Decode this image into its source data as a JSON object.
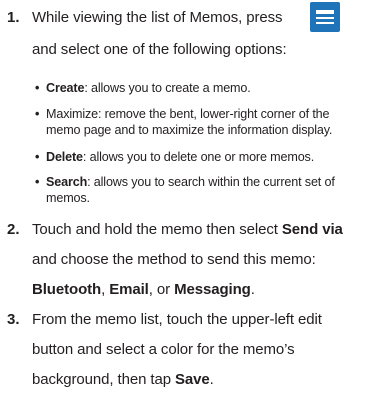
{
  "steps": [
    {
      "number": "1.",
      "line1_text": "While viewing the list of Memos, press",
      "line2_text": "and select one of the following options:",
      "icon": "menu-icon",
      "bullets": [
        {
          "bold": "Create",
          "rest": ": allows you to create a memo.",
          "rest2": ""
        },
        {
          "bold": "",
          "rest": "Maximize: remove the bent, lower-right corner of the",
          "rest2": "memo page and to maximize the information display."
        },
        {
          "bold": "Delete",
          "rest": ": allows you to delete one or more memos.",
          "rest2": ""
        },
        {
          "bold": "Search",
          "rest": ": allows you to search within the current set of",
          "rest2": "memos."
        }
      ]
    },
    {
      "number": "2.",
      "line1_text": "Touch and hold the memo then select ",
      "line1_bold": "Send via",
      "line2_text": "and choose the method to send this memo:",
      "line3_b1": "Bluetooth",
      "line3_sep1": ", ",
      "line3_b2": "Email",
      "line3_sep2": ", or ",
      "line3_b3": "Messaging",
      "line3_end": "."
    },
    {
      "number": "3.",
      "line1_text": "From the memo list, touch the upper-left edit",
      "line2_text": "button and select a color for the memo’s",
      "line3_text": "background, then tap ",
      "line3_bold": "Save",
      "line3_end": "."
    }
  ],
  "colors": {
    "text": "#231f20",
    "icon_bg": "#1f73b9"
  }
}
